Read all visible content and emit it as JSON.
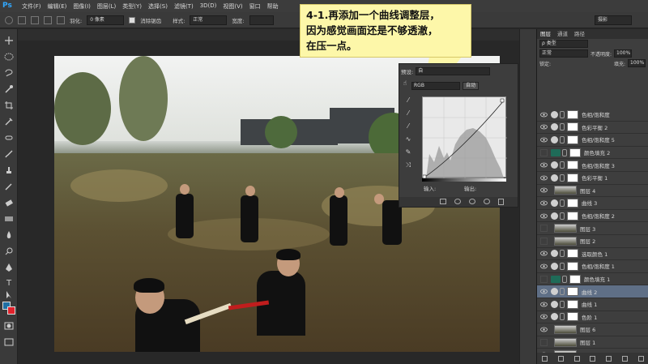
{
  "app": {
    "logo": "Ps"
  },
  "menu": {
    "items": [
      "文件(F)",
      "编辑(E)",
      "图像(I)",
      "图层(L)",
      "类型(Y)",
      "选择(S)",
      "滤镜(T)",
      "3D(D)",
      "视图(V)",
      "窗口",
      "帮助"
    ]
  },
  "options_bar": {
    "feather_label": "羽化:",
    "feather_value": "0 像素",
    "antialias_label": "消除锯齿",
    "style_label": "样式:",
    "style_value": "正常",
    "width_label": "宽度:",
    "workspace_value": "摄影"
  },
  "callout": {
    "line1": "4-1.再添加一个曲线调整层，",
    "line2": "因为感觉画面还是不够透澈，",
    "line3": "在压一点。"
  },
  "properties": {
    "preset_label": "预设:",
    "preset_value": "自",
    "channel_value": "RGB",
    "auto_button": "自动",
    "input_label": "输入:",
    "output_label": "输出:"
  },
  "layers_panel": {
    "tabs": [
      "图层",
      "通道",
      "路径"
    ],
    "filter_value": "ρ 类型",
    "blend_mode": "正常",
    "opacity_label": "不透明度:",
    "opacity_value": "100%",
    "lock_label": "锁定:",
    "fill_label": "填充:",
    "fill_value": "100%",
    "layers": [
      {
        "name": "色相/饱和度",
        "kind": "adjust",
        "visible": true,
        "selected": false
      },
      {
        "name": "色彩平衡 2",
        "kind": "adjust",
        "visible": true,
        "selected": false
      },
      {
        "name": "色相/饱和度 5",
        "kind": "adjust",
        "visible": true,
        "selected": false
      },
      {
        "name": "颜色填充 2",
        "kind": "fill",
        "visible": false,
        "selected": false
      },
      {
        "name": "色相/饱和度 3",
        "kind": "adjust",
        "visible": true,
        "selected": false
      },
      {
        "name": "色彩平衡 1",
        "kind": "adjust",
        "visible": true,
        "selected": false
      },
      {
        "name": "图层 4",
        "kind": "image",
        "visible": true,
        "selected": false
      },
      {
        "name": "曲线 3",
        "kind": "adjust",
        "visible": true,
        "selected": false
      },
      {
        "name": "色相/饱和度 2",
        "kind": "adjust",
        "visible": true,
        "selected": false
      },
      {
        "name": "图层 3",
        "kind": "image",
        "visible": false,
        "selected": false
      },
      {
        "name": "图层 2",
        "kind": "image",
        "visible": false,
        "selected": false
      },
      {
        "name": "选取颜色 1",
        "kind": "adjust",
        "visible": true,
        "selected": false
      },
      {
        "name": "色相/饱和度 1",
        "kind": "adjust",
        "visible": true,
        "selected": false
      },
      {
        "name": "颜色填充 1",
        "kind": "fill",
        "visible": false,
        "selected": false
      },
      {
        "name": "曲线 2",
        "kind": "adjust",
        "visible": true,
        "selected": true
      },
      {
        "name": "曲线 1",
        "kind": "adjust",
        "visible": true,
        "selected": false
      },
      {
        "name": "色阶 1",
        "kind": "adjust",
        "visible": true,
        "selected": false
      },
      {
        "name": "图层 6",
        "kind": "image",
        "visible": true,
        "selected": false
      },
      {
        "name": "图层 1",
        "kind": "image",
        "visible": false,
        "selected": false
      },
      {
        "name": "背景",
        "kind": "image",
        "visible": true,
        "selected": false
      }
    ]
  },
  "colors": {
    "accent": "#31a8ff",
    "foreground": "#1f6fa3",
    "background": "#e0222c",
    "selected_row": "#5f6f86",
    "callout_bg": "#fdf7a9"
  }
}
